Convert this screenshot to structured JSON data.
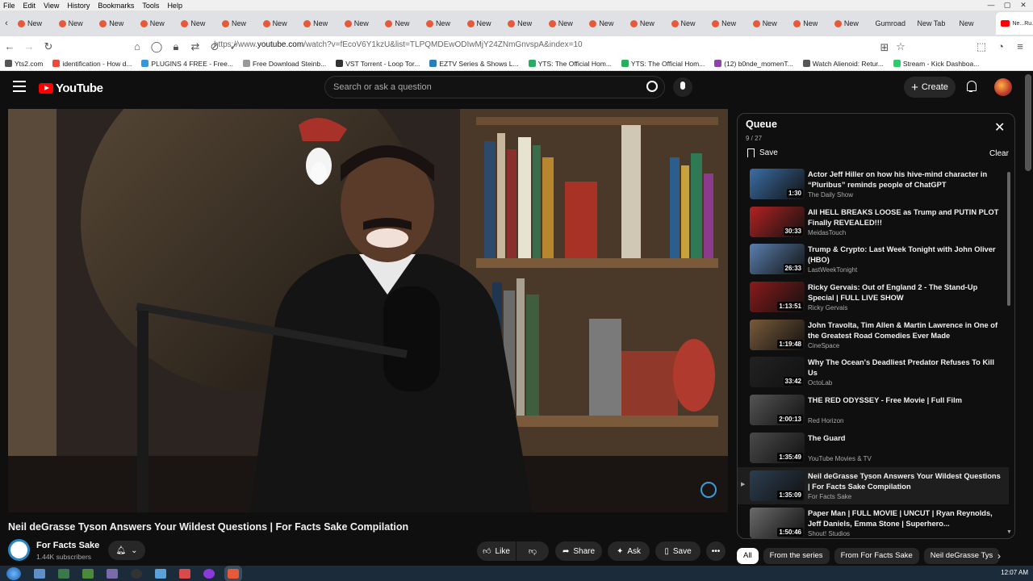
{
  "browser": {
    "menu": [
      "File",
      "Edit",
      "View",
      "History",
      "Bookmarks",
      "Tools",
      "Help"
    ],
    "tab_label": "New",
    "tab_count": 21,
    "extra_tabs": [
      "Gumroad",
      "New Tab",
      "New"
    ],
    "active_tab": "Ne...Ru...",
    "url_prefix": "https://www.",
    "url_domain": "youtube.com",
    "url_rest": "/watch?v=fEcoV6Y1kzU&list=TLPQMDEwODIwMjY24ZNmGnvspA&index=10",
    "bookmarks": [
      "Yts2.com",
      "identification - How d...",
      "PLUGINS 4 FREE - Free...",
      "Free Download Steinb...",
      "VST Torrent - Loop Tor...",
      "EZTV Series & Shows L...",
      "YTS: The Official Hom...",
      "YTS: The Official Hom...",
      "(12) b0nde_momenT...",
      "Watch Alienoid: Retur...",
      "Stream - Kick Dashboa..."
    ]
  },
  "youtube": {
    "logo_text": "YouTube",
    "search_placeholder": "Search or ask a question",
    "create_label": "Create"
  },
  "video": {
    "title": "Neil deGrasse Tyson Answers Your Wildest Questions | For Facts Sake Compilation",
    "channel": "For Facts Sake",
    "subscribers": "1.44K subscribers",
    "actions": {
      "like": "Like",
      "share": "Share",
      "ask": "Ask",
      "save": "Save"
    }
  },
  "queue": {
    "title": "Queue",
    "position": "9 / 27",
    "save": "Save",
    "clear": "Clear",
    "items": [
      {
        "title": "Actor Jeff Hiller on how his hive-mind character in “Pluribus” reminds people of ChatGPT",
        "channel": "The Daily Show",
        "duration": "1:30",
        "color": "#3b6ea5"
      },
      {
        "title": "All HELL BREAKS LOOSE as Trump and PUTIN PLOT Finally REVEALED!!!",
        "channel": "MeidasTouch",
        "duration": "30:33",
        "color": "#b22222"
      },
      {
        "title": "Trump & Crypto: Last Week Tonight with John Oliver (HBO)",
        "channel": "LastWeekTonight",
        "duration": "26:33",
        "color": "#5a7fb0"
      },
      {
        "title": "Ricky Gervais: Out of England 2 - The Stand-Up Special | FULL LIVE SHOW",
        "channel": "Ricky Gervais",
        "duration": "1:13:51",
        "color": "#8b1a1a"
      },
      {
        "title": "John Travolta, Tim Allen & Martin Lawrence in One of the Greatest Road Comedies Ever Made",
        "channel": "CineSpace",
        "duration": "1:19:48",
        "color": "#7a5a3a"
      },
      {
        "title": "Why The Ocean's Deadliest Predator Refuses To Kill Us",
        "channel": "OctoLab",
        "duration": "33:42",
        "color": "#222222"
      },
      {
        "title": "THE RED ODYSSEY - Free Movie | Full Film",
        "channel": "Red Horizon",
        "duration": "2:00:13",
        "color": "#555555"
      },
      {
        "title": "The Guard",
        "channel": "YouTube Movies & TV",
        "duration": "1:35:49",
        "color": "#4a4a4a"
      },
      {
        "title": "Neil deGrasse Tyson Answers Your Wildest Questions | For Facts Sake Compilation",
        "channel": "For Facts Sake",
        "duration": "1:35:09",
        "color": "#2c3e50",
        "active": true
      },
      {
        "title": "Paper Man | FULL MOVIE | UNCUT | Ryan Reynolds, Jeff Daniels, Emma Stone | Superhero...",
        "channel": "Shout! Studios",
        "duration": "1:50:46",
        "color": "#6b6b6b"
      }
    ]
  },
  "chips": [
    "All",
    "From the series",
    "From For Facts Sake",
    "Neil deGrasse Tys"
  ],
  "taskbar": {
    "clock": "12:07 AM"
  }
}
